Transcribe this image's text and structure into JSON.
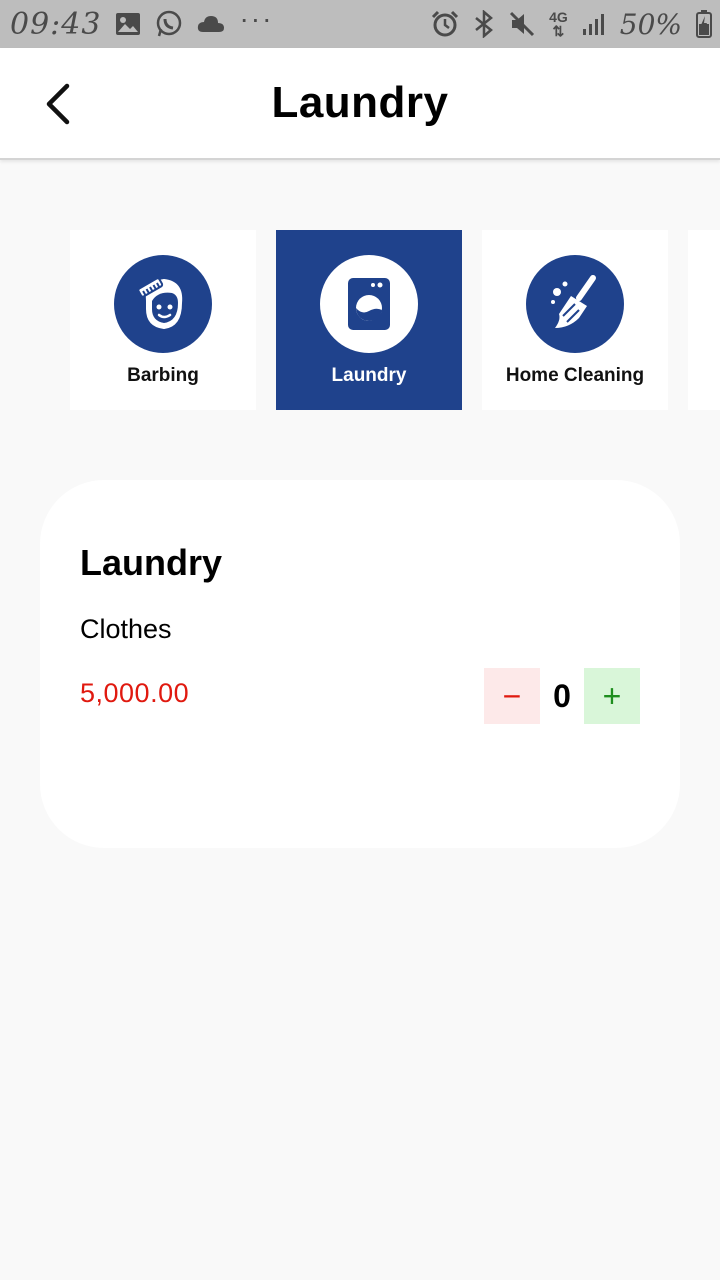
{
  "status_bar": {
    "time": "09:43",
    "battery_percent": "50%",
    "network": "4G",
    "overflow": "···",
    "icons": [
      "gallery-icon",
      "whatsapp-icon",
      "cloud-icon",
      "alarm-icon",
      "bluetooth-icon",
      "mute-icon",
      "signal-icon",
      "battery-icon"
    ]
  },
  "header": {
    "title": "Laundry",
    "back_icon": "chevron-left-icon"
  },
  "categories": [
    {
      "label": "Barbing",
      "icon": "barber-icon",
      "selected": false
    },
    {
      "label": "Laundry",
      "icon": "washing-machine-icon",
      "selected": true
    },
    {
      "label": "Home Cleaning",
      "icon": "broom-icon",
      "selected": false
    }
  ],
  "service": {
    "title": "Laundry",
    "item_name": "Clothes",
    "price": "5,000.00",
    "quantity": "0",
    "decrement_symbol": "−",
    "increment_symbol": "+"
  },
  "colors": {
    "brand_blue": "#1f428c",
    "price_red": "#e0190f",
    "increment_green": "#1e8e1e",
    "status_bar_gray": "#bdbdbd"
  }
}
